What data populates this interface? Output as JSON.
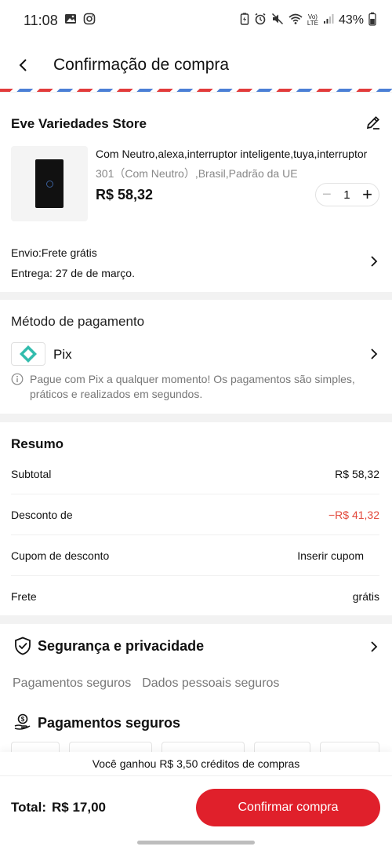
{
  "status_bar": {
    "time": "11:08",
    "battery": "43%",
    "network": "LTE",
    "volte": "Vo)"
  },
  "header": {
    "title": "Confirmação de compra"
  },
  "store": {
    "name": "Eve Variedades Store",
    "product": {
      "title": "Com Neutro,alexa,interruptor inteligente,tuya,interruptor",
      "variant": "301（Com Neutro）,Brasil,Padrão da UE",
      "price": "R$ 58,32",
      "quantity": "1",
      "minus": "−",
      "plus": "+"
    },
    "shipping": "Envio:Frete grátis",
    "delivery": "Entrega: 27 de de março."
  },
  "payment": {
    "title": "Método de pagamento",
    "method": "Pix",
    "note": "Pague com Pix a qualquer momento! Os pagamentos são simples, práticos e realizados em segundos."
  },
  "summary": {
    "title": "Resumo",
    "rows": [
      {
        "label": "Subtotal",
        "value": "R$ 58,32"
      },
      {
        "label": "Desconto de",
        "value": "−R$ 41,32"
      },
      {
        "label": "Cupom de desconto",
        "value": "Inserir cupom"
      },
      {
        "label": "Frete",
        "value": "grátis"
      }
    ]
  },
  "security": {
    "title": "Segurança e privacidade",
    "tags": [
      "Pagamentos seguros",
      "Dados pessoais seguros"
    ],
    "payments_title": "Pagamentos seguros"
  },
  "credits_banner": "Você ganhou R$ 3,50 créditos de compras",
  "footer": {
    "total_label": "Total:",
    "total_value": "R$ 17,00",
    "confirm_label": "Confirmar compra"
  },
  "colors": {
    "accent": "#e0202b",
    "discount": "#e2473a",
    "pix": "#32bcad"
  }
}
